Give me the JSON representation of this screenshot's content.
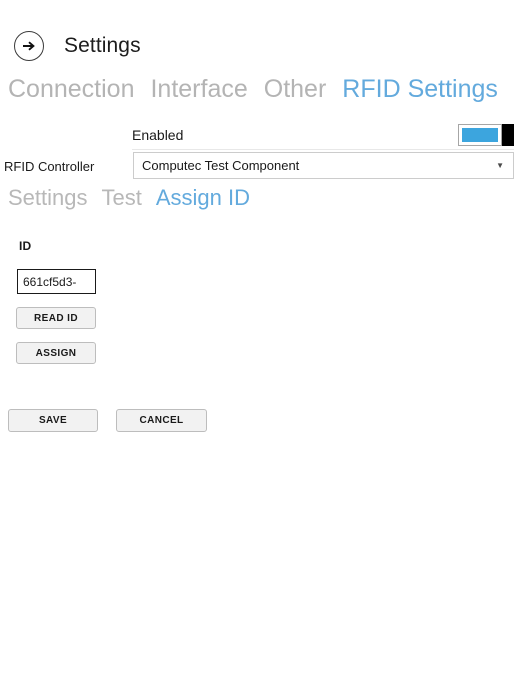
{
  "header": {
    "back_icon": "arrow-right-circle-icon",
    "title": "Settings"
  },
  "tabs": [
    {
      "label": "Connection",
      "active": false
    },
    {
      "label": "Interface",
      "active": false
    },
    {
      "label": "Other",
      "active": false
    },
    {
      "label": "RFID Settings",
      "active": true
    }
  ],
  "enabled": {
    "label": "Enabled",
    "state": "on"
  },
  "controller": {
    "label": "RFID Controller",
    "value": "Computec Test Component",
    "arrow_icon": "chevron-down-icon"
  },
  "subtabs": [
    {
      "label": "Settings",
      "active": false
    },
    {
      "label": "Test",
      "active": false
    },
    {
      "label": "Assign ID",
      "active": true
    }
  ],
  "assign_id": {
    "id_label": "ID",
    "id_value": "661cf5d3-",
    "id_placeholder": "",
    "read_id_label": "READ ID",
    "assign_label": "ASSIGN"
  },
  "footer": {
    "save_label": "SAVE",
    "cancel_label": "CANCEL"
  },
  "colors": {
    "accent_blue": "#63aadd",
    "toggle_blue": "#3ca5de",
    "inactive_grey": "#b4b4b4"
  }
}
